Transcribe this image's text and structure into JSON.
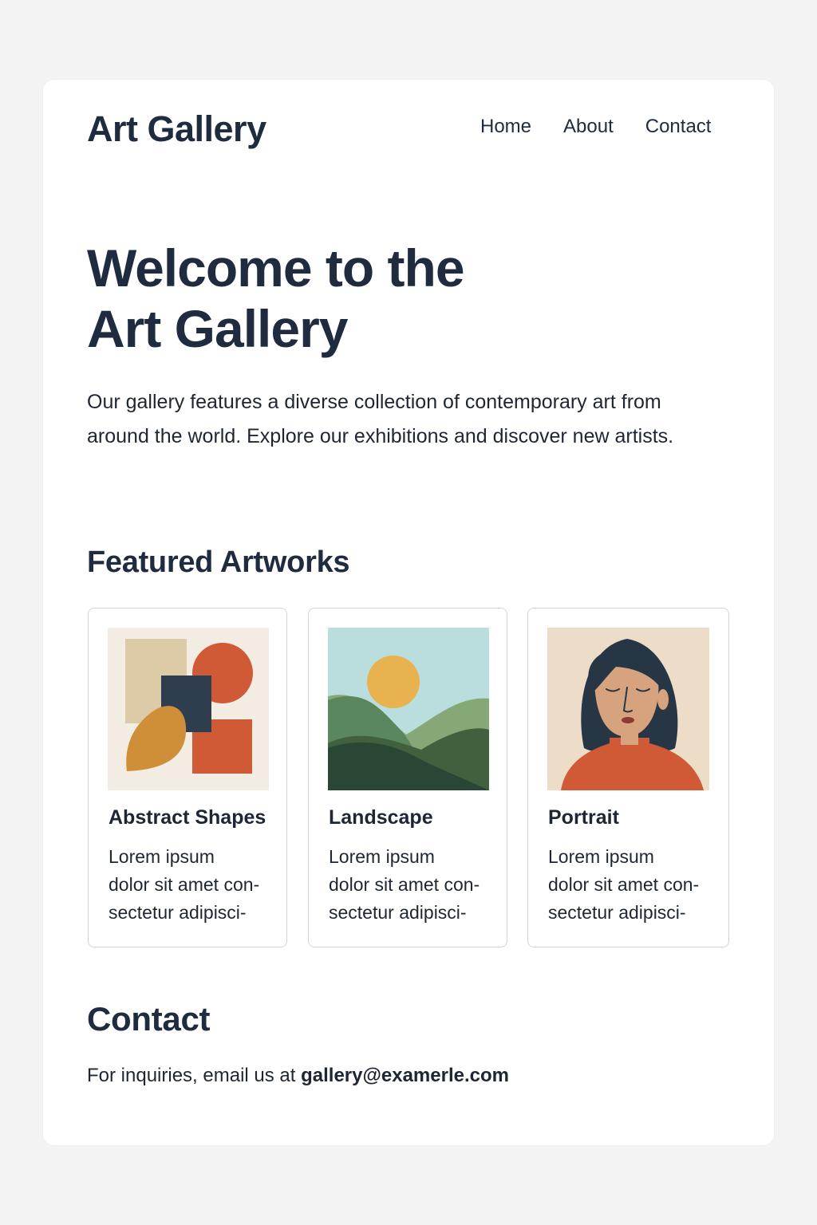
{
  "site": {
    "title": "Art Gallery"
  },
  "nav": {
    "items": [
      {
        "label": "Home"
      },
      {
        "label": "About"
      },
      {
        "label": "Contact"
      }
    ]
  },
  "hero": {
    "title": "Welcome to the\nArt Gallery",
    "title_line_1": "Welcome to the",
    "title_line_2": "Art Gallery",
    "description": "Our gallery features a diverse collection of contemporary art from around the world. Explore our exhibitions and discover new artists."
  },
  "featured": {
    "heading": "Featured Artworks",
    "artworks": [
      {
        "title": "Abstract Shapes",
        "description": "Lorem ipsum\ndolor sit amet con-\nsectetur adipisci-",
        "image": "abstract-shapes-artwork"
      },
      {
        "title": "Landscape",
        "description": "Lorem ipsum\ndolor sit amet con-\nsectetur adipisci-",
        "image": "landscape-artwork"
      },
      {
        "title": "Portrait",
        "description": "Lorem ipsum\ndolor sit amet con-\nsectetur adipisci-",
        "image": "portrait-artwork"
      }
    ]
  },
  "contact": {
    "heading": "Contact",
    "text_prefix": "For inquiries, email us at ",
    "email": "gallery@examerle.com"
  },
  "colors": {
    "page_background": "#f3f3f3",
    "card_background": "#ffffff",
    "heading": "#1f2b3e",
    "text": "#1f2633",
    "card_border": "#d3d5d8",
    "artwork_orange": "#cf5a35",
    "artwork_navy": "#2f3e4f",
    "artwork_sand": "#ddcba7",
    "artwork_gold": "#cf8f38",
    "sky": "#b9dedd",
    "sun": "#e8b24f",
    "hill_light": "#86a877",
    "hill_mid": "#5a875e",
    "hill_dark": "#2f4d35",
    "portrait_background": "#ecdcc8",
    "portrait_skin": "#d7a37e",
    "portrait_hair": "#263645",
    "portrait_shirt": "#cf5a35"
  }
}
